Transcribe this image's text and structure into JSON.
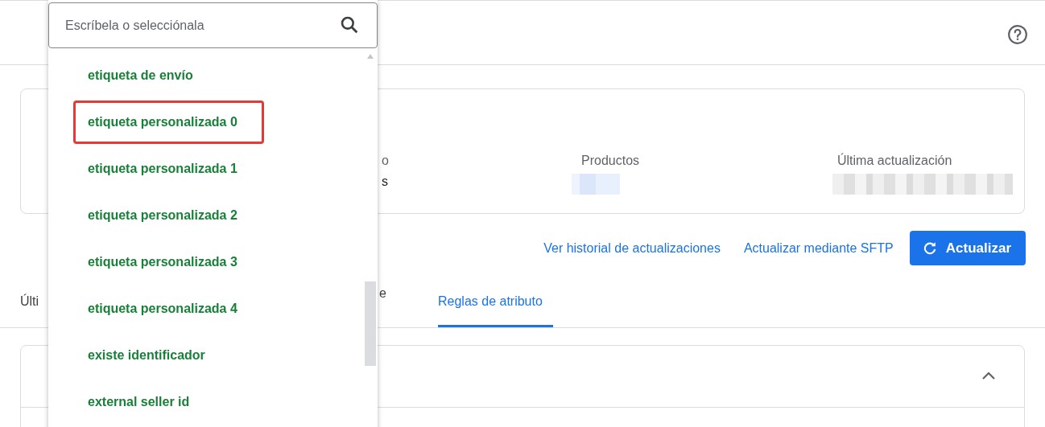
{
  "summary_card": {
    "fields": [
      {
        "label": "o",
        "value": "s",
        "value_redacted": false
      },
      {
        "label": "Productos",
        "value_redacted": true
      },
      {
        "label": "Última actualización",
        "value_redacted": true
      }
    ]
  },
  "actions": {
    "links": [
      "Ver historial de actualizaciones",
      "Actualizar mediante SFTP"
    ],
    "button": "Actualizar"
  },
  "tabs": [
    {
      "label": "Últi",
      "selected": false
    },
    {
      "label": "e",
      "selected": false
    },
    {
      "label": "Reglas de atributo",
      "selected": true
    }
  ],
  "section_card": {
    "expanded": true
  },
  "dropdown": {
    "search": {
      "placeholder": "Escríbela o selecciónala"
    },
    "options": [
      {
        "label": "etiqueta de envío",
        "highlighted": false
      },
      {
        "label": "etiqueta personalizada 0",
        "highlighted": true
      },
      {
        "label": "etiqueta personalizada 1",
        "highlighted": false
      },
      {
        "label": "etiqueta personalizada 2",
        "highlighted": false
      },
      {
        "label": "etiqueta personalizada 3",
        "highlighted": false
      },
      {
        "label": "etiqueta personalizada 4",
        "highlighted": false
      },
      {
        "label": "existe identificador",
        "highlighted": false
      },
      {
        "label": "external seller id",
        "highlighted": false
      }
    ]
  }
}
